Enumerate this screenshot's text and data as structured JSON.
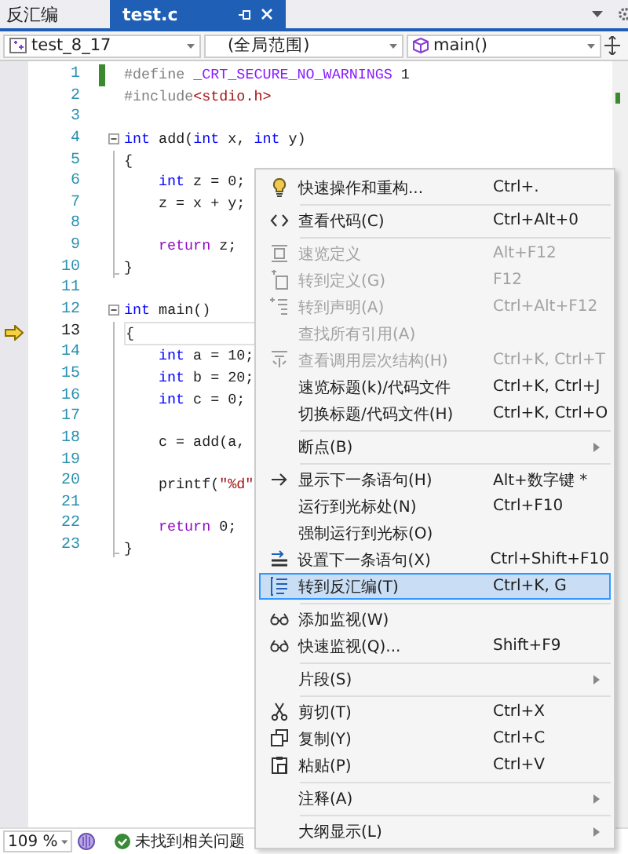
{
  "tabs": [
    {
      "label": "反汇编",
      "selected": false
    },
    {
      "label": "test.c",
      "selected": true
    }
  ],
  "nav_bar": [
    {
      "kind": "project",
      "value": "test_8_17"
    },
    {
      "kind": "scope",
      "value": "(全局范围)"
    },
    {
      "kind": "function",
      "value": "main()"
    }
  ],
  "editor": {
    "lines": [
      {
        "number": "1",
        "kind": "top",
        "changed": true,
        "current": false,
        "tokens": [
          {
            "kind": "pre",
            "text": "#define "
          },
          {
            "kind": "macro",
            "text": "_CRT_SECURE_NO_WARNINGS"
          },
          {
            "kind": "plain",
            "text": " 1"
          }
        ]
      },
      {
        "number": "2",
        "kind": "top",
        "changed": false,
        "current": false,
        "tokens": [
          {
            "kind": "pre",
            "text": "#include"
          },
          {
            "kind": "string",
            "text": "<stdio.h>"
          }
        ]
      },
      {
        "number": "3",
        "kind": "blank",
        "changed": false,
        "current": false
      },
      {
        "number": "4",
        "kind": "header",
        "changed": false,
        "current": false,
        "tokens": [
          {
            "kind": "keyword",
            "text": "int"
          },
          {
            "kind": "ident",
            "text": " add("
          },
          {
            "kind": "keyword",
            "text": "int"
          },
          {
            "kind": "ident",
            "text": " x, "
          },
          {
            "kind": "keyword",
            "text": "int"
          },
          {
            "kind": "ident",
            "text": " y)"
          }
        ]
      },
      {
        "number": "5",
        "kind": "brace",
        "changed": false,
        "current": false,
        "tokens": [
          {
            "kind": "plain",
            "text": "{"
          }
        ]
      },
      {
        "number": "6",
        "kind": "statement",
        "changed": false,
        "current": false,
        "tokens": [
          {
            "kind": "keyword",
            "text": "int"
          },
          {
            "kind": "ident",
            "text": " z = 0;"
          }
        ]
      },
      {
        "number": "7",
        "kind": "statement",
        "changed": false,
        "current": false,
        "tokens": [
          {
            "kind": "ident",
            "text": "z = x + y;"
          }
        ]
      },
      {
        "number": "8",
        "kind": "inner_blank",
        "changed": false,
        "current": false
      },
      {
        "number": "9",
        "kind": "statement",
        "changed": false,
        "current": false,
        "tokens": [
          {
            "kind": "control",
            "text": "return"
          },
          {
            "kind": "ident",
            "text": " z;"
          }
        ]
      },
      {
        "number": "10",
        "kind": "close",
        "changed": false,
        "current": false,
        "tokens": [
          {
            "kind": "plain",
            "text": "}"
          }
        ]
      },
      {
        "number": "11",
        "kind": "blank",
        "changed": false,
        "current": false
      },
      {
        "number": "12",
        "kind": "header",
        "changed": false,
        "current": false,
        "tokens": [
          {
            "kind": "keyword",
            "text": "int"
          },
          {
            "kind": "ident",
            "text": " main()"
          }
        ]
      },
      {
        "number": "13",
        "kind": "brace",
        "changed": false,
        "current": true,
        "tokens": [
          {
            "kind": "plain",
            "text": "{"
          }
        ]
      },
      {
        "number": "14",
        "kind": "statement",
        "changed": false,
        "current": false,
        "tokens": [
          {
            "kind": "keyword",
            "text": "int"
          },
          {
            "kind": "ident",
            "text": " a = 10;"
          }
        ]
      },
      {
        "number": "15",
        "kind": "statement",
        "changed": false,
        "current": false,
        "tokens": [
          {
            "kind": "keyword",
            "text": "int"
          },
          {
            "kind": "ident",
            "text": " b = 20;"
          }
        ]
      },
      {
        "number": "16",
        "kind": "statement",
        "changed": false,
        "current": false,
        "tokens": [
          {
            "kind": "keyword",
            "text": "int"
          },
          {
            "kind": "ident",
            "text": " c = 0;"
          }
        ]
      },
      {
        "number": "17",
        "kind": "inner_blank",
        "changed": false,
        "current": false
      },
      {
        "number": "18",
        "kind": "statement",
        "changed": false,
        "current": false,
        "tokens": [
          {
            "kind": "ident",
            "text": "c = add(a,"
          }
        ]
      },
      {
        "number": "19",
        "kind": "inner_blank",
        "changed": false,
        "current": false
      },
      {
        "number": "20",
        "kind": "statement",
        "changed": false,
        "current": false,
        "tokens": [
          {
            "kind": "ident",
            "text": "printf("
          },
          {
            "kind": "string",
            "text": "\"%d\""
          }
        ]
      },
      {
        "number": "21",
        "kind": "inner_blank",
        "changed": false,
        "current": false
      },
      {
        "number": "22",
        "kind": "statement",
        "changed": false,
        "current": false,
        "tokens": [
          {
            "kind": "control",
            "text": "return"
          },
          {
            "kind": "ident",
            "text": " 0;"
          }
        ]
      },
      {
        "number": "23",
        "kind": "close",
        "changed": false,
        "current": false,
        "tokens": [
          {
            "kind": "plain",
            "text": "}"
          }
        ]
      }
    ]
  },
  "context_menu": [
    {
      "kind": "item",
      "label": "快速操作和重构...",
      "shortcut": "Ctrl+.",
      "disabled": false,
      "selected": false,
      "submenu": false
    },
    {
      "kind": "separator"
    },
    {
      "kind": "item",
      "label": "查看代码(C)",
      "shortcut": "Ctrl+Alt+0",
      "disabled": false,
      "selected": false,
      "submenu": false
    },
    {
      "kind": "separator"
    },
    {
      "kind": "item",
      "label": "速览定义",
      "shortcut": "Alt+F12",
      "disabled": true,
      "selected": false,
      "submenu": false
    },
    {
      "kind": "item",
      "label": "转到定义(G)",
      "shortcut": "F12",
      "disabled": true,
      "selected": false,
      "submenu": false
    },
    {
      "kind": "item",
      "label": "转到声明(A)",
      "shortcut": "Ctrl+Alt+F12",
      "disabled": true,
      "selected": false,
      "submenu": false
    },
    {
      "kind": "item",
      "label": "查找所有引用(A)",
      "disabled": true,
      "selected": false,
      "submenu": false
    },
    {
      "kind": "item",
      "label": "查看调用层次结构(H)",
      "shortcut": "Ctrl+K, Ctrl+T",
      "disabled": true,
      "selected": false,
      "submenu": false
    },
    {
      "kind": "item",
      "label": "速览标题(k)/代码文件",
      "shortcut": "Ctrl+K, Ctrl+J",
      "disabled": false,
      "selected": false,
      "submenu": false
    },
    {
      "kind": "item",
      "label": "切换标题/代码文件(H)",
      "shortcut": "Ctrl+K, Ctrl+O",
      "disabled": false,
      "selected": false,
      "submenu": false
    },
    {
      "kind": "separator"
    },
    {
      "kind": "item",
      "label": "断点(B)",
      "disabled": false,
      "selected": false,
      "submenu": true
    },
    {
      "kind": "separator"
    },
    {
      "kind": "item",
      "label": "显示下一条语句(H)",
      "shortcut": "Alt+数字键 *",
      "disabled": false,
      "selected": false,
      "submenu": false
    },
    {
      "kind": "item",
      "label": "运行到光标处(N)",
      "shortcut": "Ctrl+F10",
      "disabled": false,
      "selected": false,
      "submenu": false
    },
    {
      "kind": "item",
      "label": "强制运行到光标(O)",
      "disabled": false,
      "selected": false,
      "submenu": false
    },
    {
      "kind": "item",
      "label": "设置下一条语句(X)",
      "shortcut": "Ctrl+Shift+F10",
      "disabled": false,
      "selected": false,
      "submenu": false
    },
    {
      "kind": "item",
      "label": "转到反汇编(T)",
      "shortcut": "Ctrl+K, G",
      "disabled": false,
      "selected": true,
      "submenu": false
    },
    {
      "kind": "separator"
    },
    {
      "kind": "item",
      "label": "添加监视(W)",
      "disabled": false,
      "selected": false,
      "submenu": false
    },
    {
      "kind": "item",
      "label": "快速监视(Q)...",
      "shortcut": "Shift+F9",
      "disabled": false,
      "selected": false,
      "submenu": false
    },
    {
      "kind": "separator"
    },
    {
      "kind": "item",
      "label": "片段(S)",
      "disabled": false,
      "selected": false,
      "submenu": true
    },
    {
      "kind": "separator"
    },
    {
      "kind": "item",
      "label": "剪切(T)",
      "shortcut": "Ctrl+X",
      "disabled": false,
      "selected": false,
      "submenu": false
    },
    {
      "kind": "item",
      "label": "复制(Y)",
      "shortcut": "Ctrl+C",
      "disabled": false,
      "selected": false,
      "submenu": false
    },
    {
      "kind": "item",
      "label": "粘贴(P)",
      "shortcut": "Ctrl+V",
      "disabled": false,
      "selected": false,
      "submenu": false
    },
    {
      "kind": "separator"
    },
    {
      "kind": "item",
      "label": "注释(A)",
      "disabled": false,
      "selected": false,
      "submenu": true
    },
    {
      "kind": "separator"
    },
    {
      "kind": "item",
      "label": "大纲显示(L)",
      "disabled": false,
      "selected": false,
      "submenu": true
    }
  ],
  "status_bar": {
    "zoom": "109 %",
    "issues": "未找到相关问题"
  }
}
